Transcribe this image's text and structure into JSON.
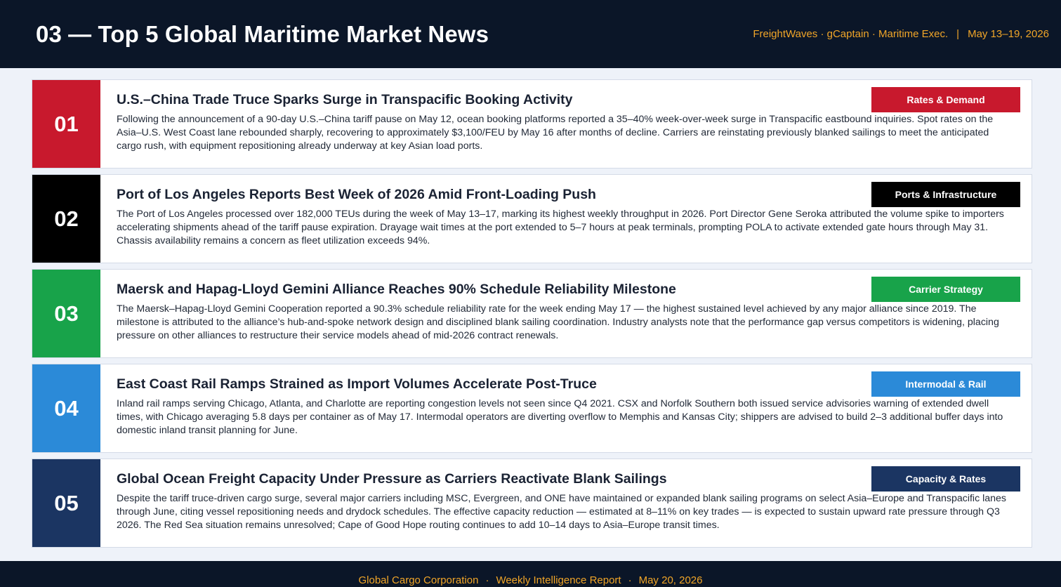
{
  "header": {
    "title": "03 — Top 5 Global Maritime Market News",
    "sources": "FreightWaves · gCaptain · Maritime Exec.",
    "separator": "|",
    "date_range": "May 13–19, 2026"
  },
  "colors": {
    "red": "#c8192d",
    "black": "#000000",
    "green": "#18a34a",
    "blue": "#2b8ad8",
    "navy": "#1b3562",
    "header_bg": "#0b1628",
    "accent": "#f0a528"
  },
  "news": [
    {
      "number": "01",
      "title": "U.S.–China Trade Truce Sparks Surge in Transpacific Booking Activity",
      "tag": "Rates & Demand",
      "color": "#c8192d",
      "description": "Following the announcement of a 90-day U.S.–China tariff pause on May 12, ocean booking platforms reported a 35–40% week-over-week surge in Transpacific eastbound inquiries. Spot rates on the Asia–U.S. West Coast lane rebounded sharply, recovering to approximately $3,100/FEU by May 16 after months of decline. Carriers are reinstating previously blanked sailings to meet the anticipated cargo rush, with equipment repositioning already underway at key Asian load ports."
    },
    {
      "number": "02",
      "title": "Port of Los Angeles Reports Best Week of 2026 Amid Front-Loading Push",
      "tag": "Ports & Infrastructure",
      "color": "#000000",
      "description": "The Port of Los Angeles processed over 182,000 TEUs during the week of May 13–17, marking its highest weekly throughput in 2026. Port Director Gene Seroka attributed the volume spike to importers accelerating shipments ahead of the tariff pause expiration. Drayage wait times at the port extended to 5–7 hours at peak terminals, prompting POLA to activate extended gate hours through May 31. Chassis availability remains a concern as fleet utilization exceeds 94%."
    },
    {
      "number": "03",
      "title": "Maersk and Hapag-Lloyd Gemini Alliance Reaches 90% Schedule Reliability Milestone",
      "tag": "Carrier Strategy",
      "color": "#18a34a",
      "description": "The Maersk–Hapag-Lloyd Gemini Cooperation reported a 90.3% schedule reliability rate for the week ending May 17 — the highest sustained level achieved by any major alliance since 2019. The milestone is attributed to the alliance’s hub-and-spoke network design and disciplined blank sailing coordination. Industry analysts note that the performance gap versus competitors is widening, placing pressure on other alliances to restructure their service models ahead of mid-2026 contract renewals."
    },
    {
      "number": "04",
      "title": "East Coast Rail Ramps Strained as Import Volumes Accelerate Post-Truce",
      "tag": "Intermodal & Rail",
      "color": "#2b8ad8",
      "description": "Inland rail ramps serving Chicago, Atlanta, and Charlotte are reporting congestion levels not seen since Q4 2021. CSX and Norfolk Southern both issued service advisories warning of extended dwell times, with Chicago averaging 5.8 days per container as of May 17. Intermodal operators are diverting overflow to Memphis and Kansas City; shippers are advised to build 2–3 additional buffer days into domestic inland transit planning for June."
    },
    {
      "number": "05",
      "title": "Global Ocean Freight Capacity Under Pressure as Carriers Reactivate Blank Sailings",
      "tag": "Capacity & Rates",
      "color": "#1b3562",
      "description": "Despite the tariff truce-driven cargo surge, several major carriers including MSC, Evergreen, and ONE have maintained or expanded blank sailing programs on select Asia–Europe and Transpacific lanes through June, citing vessel repositioning needs and drydock schedules. The effective capacity reduction — estimated at 8–11% on key trades — is expected to sustain upward rate pressure through Q3 2026. The Red Sea situation remains unresolved; Cape of Good Hope routing continues to add 10–14 days to Asia–Europe transit times."
    }
  ],
  "footer": {
    "company": "Global Cargo Corporation",
    "dot1": "·",
    "report": "Weekly Intelligence Report",
    "dot2": "·",
    "date": "May 20, 2026"
  }
}
